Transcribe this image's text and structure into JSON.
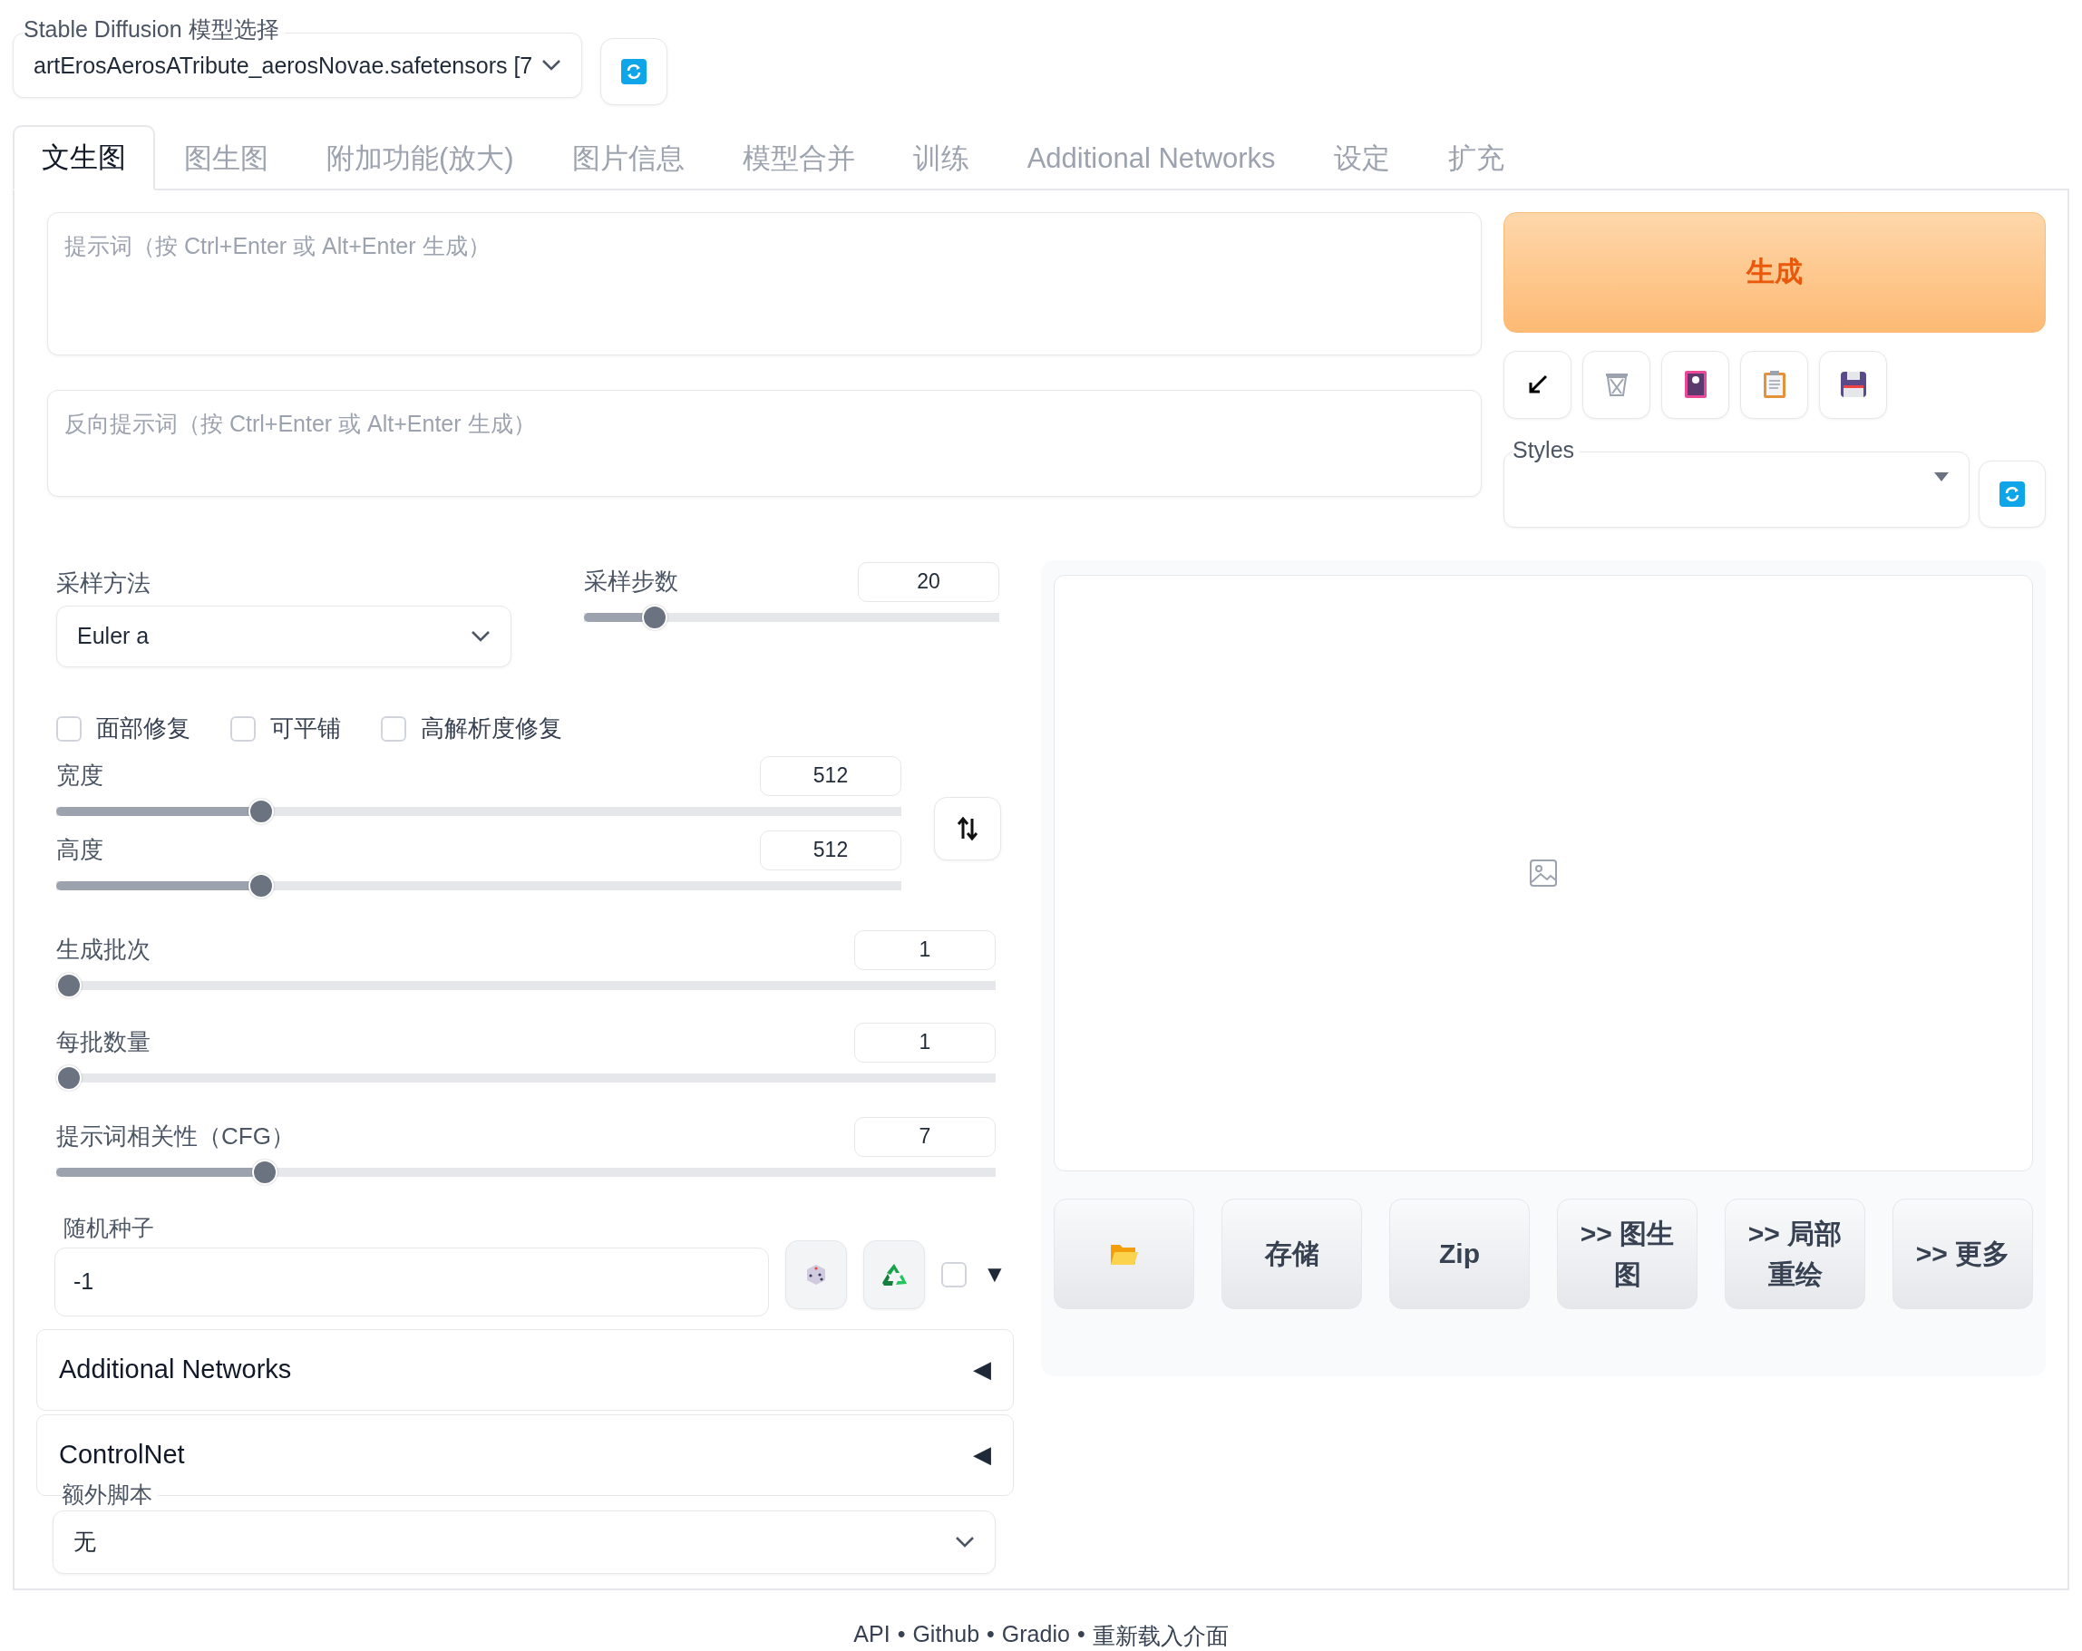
{
  "model_select": {
    "label": "Stable Diffusion 模型选择",
    "value": "artErosAerosATribute_aerosNovae.safetensors [7"
  },
  "tabs": [
    {
      "label": "文生图",
      "selected": true
    },
    {
      "label": "图生图",
      "selected": false
    },
    {
      "label": "附加功能(放大)",
      "selected": false
    },
    {
      "label": "图片信息",
      "selected": false
    },
    {
      "label": "模型合并",
      "selected": false
    },
    {
      "label": "训练",
      "selected": false
    },
    {
      "label": "Additional Networks",
      "selected": false
    },
    {
      "label": "设定",
      "selected": false
    },
    {
      "label": "扩充",
      "selected": false
    }
  ],
  "prompt": {
    "placeholder": "提示词（按 Ctrl+Enter 或 Alt+Enter 生成）"
  },
  "negative_prompt": {
    "placeholder": "反向提示词（按 Ctrl+Enter 或 Alt+Enter 生成）"
  },
  "generate_button": "生成",
  "styles": {
    "label": "Styles"
  },
  "sampler": {
    "label": "采样方法",
    "value": "Euler a"
  },
  "steps": {
    "label": "采样步数",
    "value": "20",
    "level": 0.148
  },
  "checkboxes": [
    {
      "label": "面部修复",
      "checked": false
    },
    {
      "label": "可平铺",
      "checked": false
    },
    {
      "label": "高解析度修复",
      "checked": false
    }
  ],
  "size_sliders": [
    {
      "label": "宽度",
      "value": "512",
      "level": 0.234
    },
    {
      "label": "高度",
      "value": "512",
      "level": 0.234
    }
  ],
  "batch_sliders": [
    {
      "label": "生成批次",
      "value": "1",
      "level": 0
    },
    {
      "label": "每批数量",
      "value": "1",
      "level": 0
    },
    {
      "label": "提示词相关性（CFG）",
      "value": "7",
      "level": 0.214
    }
  ],
  "seed": {
    "label": "随机种子",
    "value": "-1",
    "extra_checked": false,
    "toggle": "▼"
  },
  "accordions": [
    {
      "title": "Additional Networks",
      "toggle": "◀"
    },
    {
      "title": "ControlNet",
      "toggle": "◀"
    }
  ],
  "script": {
    "label": "额外脚本",
    "value": "无"
  },
  "output_buttons": [
    {
      "kind": "folder"
    },
    {
      "kind": "text",
      "label": "存储"
    },
    {
      "kind": "text",
      "label": "Zip"
    },
    {
      "kind": "text",
      "label": ">> 图生图"
    },
    {
      "kind": "text",
      "label": ">> 局部重绘"
    },
    {
      "kind": "text",
      "label": ">> 更多"
    }
  ],
  "footer": {
    "links": [
      "API",
      "Github",
      "Gradio",
      "重新载入介面"
    ],
    "separator": "•"
  }
}
